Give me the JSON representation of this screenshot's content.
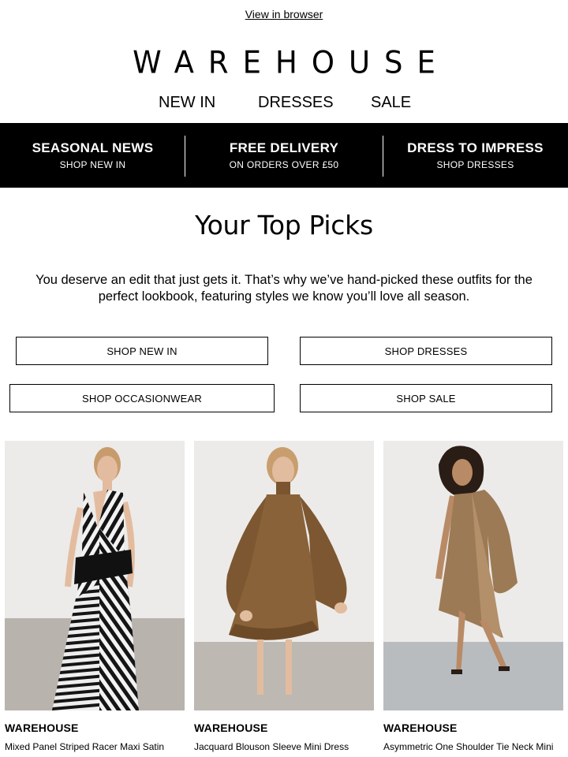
{
  "header": {
    "view_in_browser": "View in browser",
    "logo": "WAREHOUSE",
    "nav": [
      "NEW IN",
      "DRESSES",
      "SALE"
    ]
  },
  "promo_bar": {
    "items": [
      {
        "title": "SEASONAL NEWS",
        "subtitle": "SHOP NEW IN"
      },
      {
        "title": "FREE DELIVERY",
        "subtitle": "ON ORDERS OVER £50"
      },
      {
        "title": "DRESS TO IMPRESS",
        "subtitle": "SHOP DRESSES"
      }
    ]
  },
  "main": {
    "headline": "Your Top Picks",
    "intro": "You deserve an edit that just gets it. That’s why we’ve hand-picked these outfits for the perfect lookbook, featuring styles we know you’ll love all season.",
    "buttons": [
      "SHOP NEW IN",
      "SHOP DRESSES",
      "SHOP OCCASIONWEAR",
      "SHOP SALE"
    ]
  },
  "products": [
    {
      "brand": "WAREHOUSE",
      "name": "Mixed Panel Striped Racer Maxi Satin",
      "image": "model in black and white striped maxi dress"
    },
    {
      "brand": "WAREHOUSE",
      "name": "Jacquard Blouson Sleeve Mini Dress",
      "image": "model in brown jacquard mini dress"
    },
    {
      "brand": "WAREHOUSE",
      "name": "Asymmetric One Shoulder Tie Neck Mini",
      "image": "model in bronze satin asymmetric dress"
    }
  ],
  "colors": {
    "promo_bg": "#000000",
    "promo_text": "#ffffff",
    "text": "#000000"
  }
}
